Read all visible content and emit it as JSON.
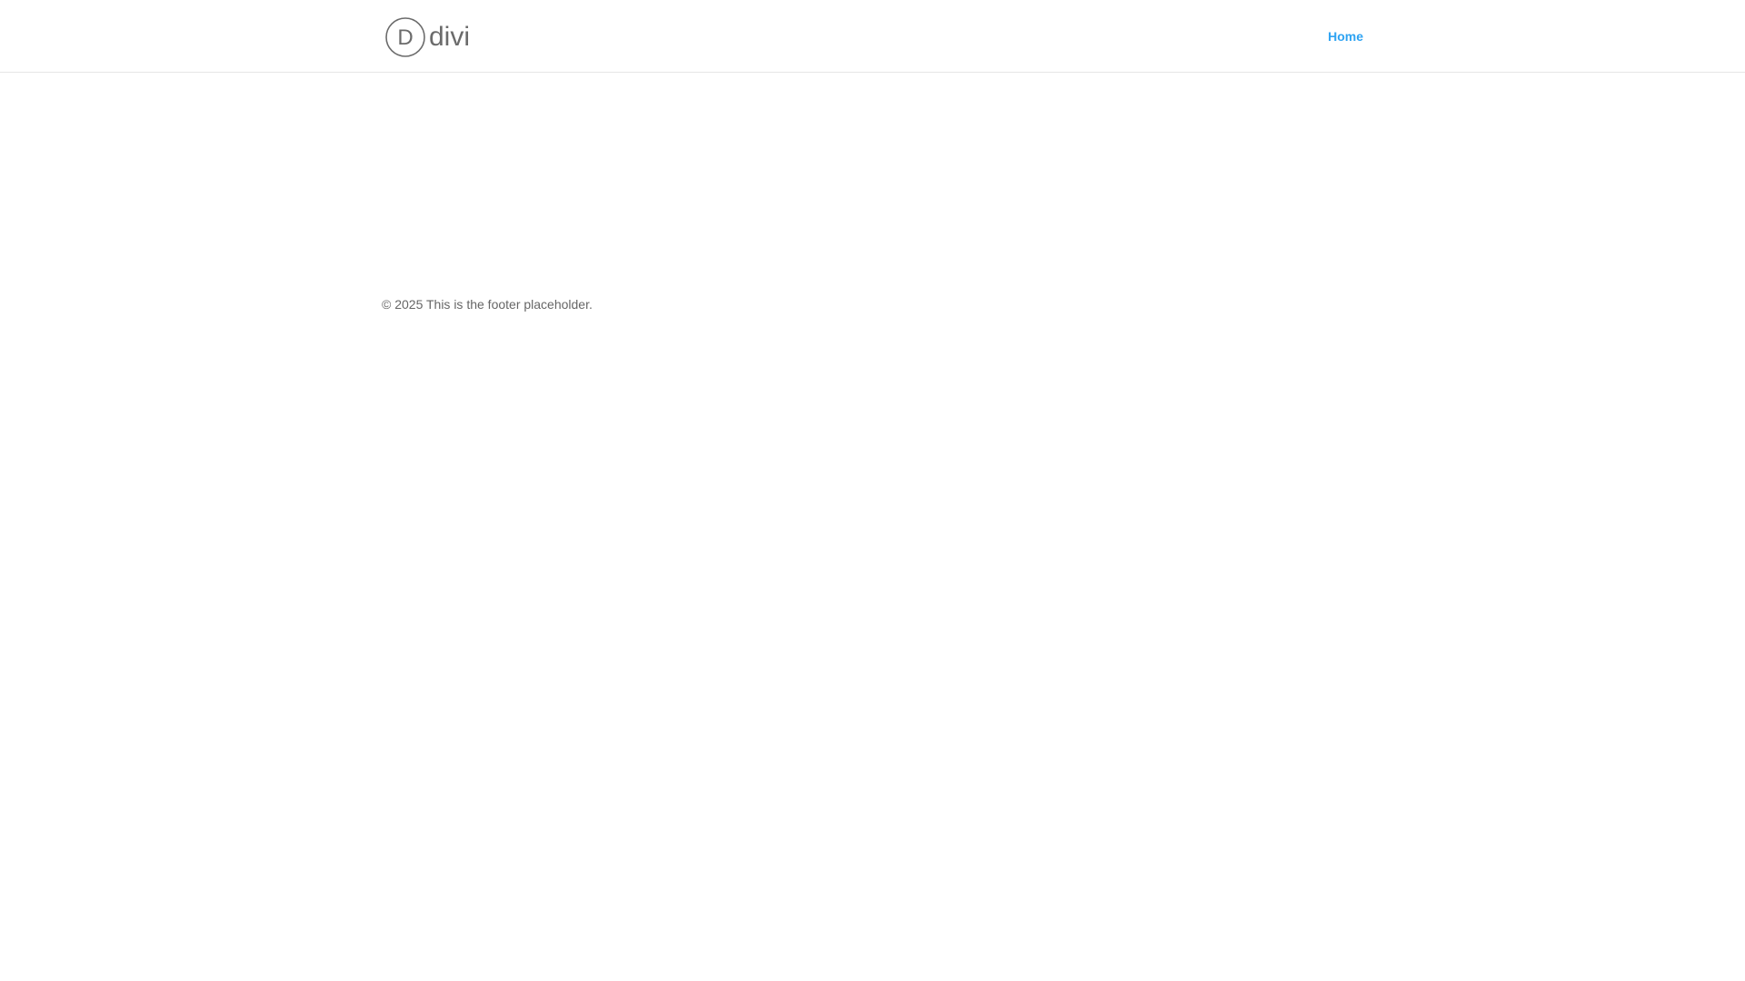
{
  "theme": {
    "accent": "#2ea3f2",
    "text_muted": "#666666",
    "header_border": "#e6e6e6",
    "background": "#ffffff"
  },
  "header": {
    "logo": {
      "wordmark": "divi",
      "monogram": "D",
      "icon": "divi-logo-icon"
    },
    "nav": {
      "items": [
        {
          "label": "Home",
          "active": true
        }
      ]
    }
  },
  "footer": {
    "text": "© 2025 This is the footer placeholder."
  }
}
